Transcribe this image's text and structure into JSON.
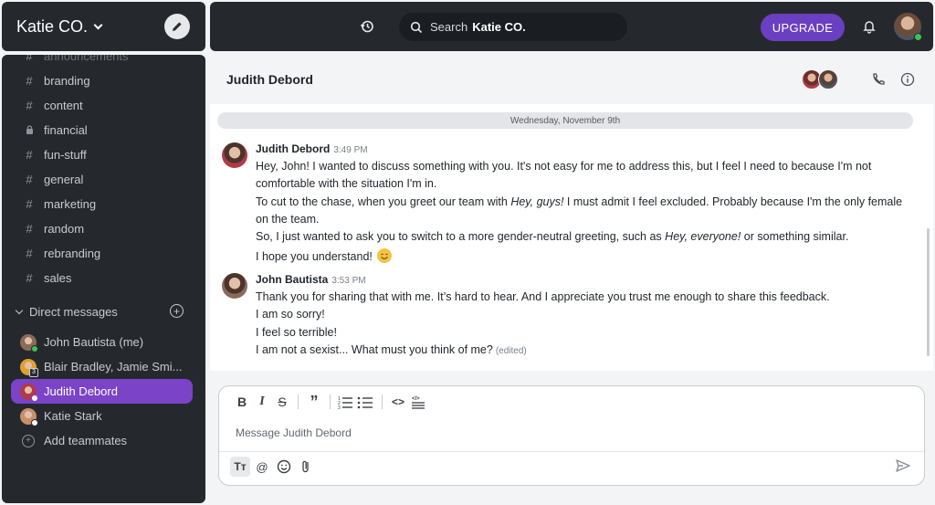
{
  "workspace": {
    "name": "Katie CO."
  },
  "channels": [
    {
      "name": "announcements",
      "icon": "hash",
      "faded": true
    },
    {
      "name": "branding",
      "icon": "hash"
    },
    {
      "name": "content",
      "icon": "hash"
    },
    {
      "name": "financial",
      "icon": "lock"
    },
    {
      "name": "fun-stuff",
      "icon": "hash"
    },
    {
      "name": "general",
      "icon": "hash"
    },
    {
      "name": "marketing",
      "icon": "hash"
    },
    {
      "name": "random",
      "icon": "hash"
    },
    {
      "name": "rebranding",
      "icon": "hash"
    },
    {
      "name": "sales",
      "icon": "hash"
    }
  ],
  "direct_messages": {
    "section_label": "Direct messages",
    "items": [
      {
        "name": "John Bautista (me)",
        "avatar_color": "#8a6b5a",
        "status_color": "#3fbf5a"
      },
      {
        "name": "Blair Bradley, Jamie Smi...",
        "avatar_color": "#e0a030",
        "badge": "3"
      },
      {
        "name": "Judith Debord",
        "avatar_color": "#b23a48",
        "status_color": "#ffffff",
        "active": true
      },
      {
        "name": "Katie Stark",
        "avatar_color": "#c88f6a",
        "status_color": "#ffffff"
      }
    ],
    "add_label": "Add teammates"
  },
  "topbar": {
    "search_prefix": "Search",
    "search_scope": "Katie CO.",
    "upgrade_label": "UPGRADE"
  },
  "conversation": {
    "title": "Judith Debord",
    "date_divider": "Wednesday, November 9th",
    "messages": [
      {
        "author": "Judith Debord",
        "time": "3:49 PM",
        "avatar_color": "#b23a48",
        "lines": [
          {
            "parts": [
              "Hey, John! I wanted to discuss something with you. It's not easy for me to address this, but I feel I need to because I'm not"
            ]
          },
          {
            "parts": [
              "comfortable with the situation I'm in."
            ]
          },
          {
            "parts": [
              "To cut to the chase, when you greet our team with ",
              "Hey, guys!",
              " I must admit I feel excluded. Probably because I'm the only female"
            ]
          },
          {
            "parts": [
              "on the team."
            ]
          },
          {
            "parts": [
              "So, I just wanted to ask you to switch to a more gender-neutral greeting, such as ",
              "Hey, everyone!",
              " or something similar."
            ]
          },
          {
            "parts": [
              "I hope you understand!"
            ],
            "emoji": "smiling-face-emoji"
          }
        ]
      },
      {
        "author": "John Bautista",
        "time": "3:53 PM",
        "avatar_color": "#8a6b5a",
        "lines": [
          {
            "parts": [
              "Thank you for sharing that with me. It’s hard to hear. And I appreciate you trust me enough to share this feedback."
            ]
          },
          {
            "parts": [
              "I am so sorry!"
            ]
          },
          {
            "parts": [
              "I feel so terrible!"
            ]
          },
          {
            "parts": [
              "I am not a sexist... What must you think of me?"
            ],
            "edited": "(edited)"
          }
        ]
      }
    ]
  },
  "composer": {
    "placeholder": "Message Judith Debord",
    "format_tools": [
      "B",
      "I",
      "S",
      "”",
      "1≡",
      "•≡",
      "<>",
      "code-block"
    ],
    "text_tool_label": "Tт"
  },
  "colors": {
    "sidebar_bg": "#25292e",
    "accent": "#7b43c8",
    "upgrade": "#6b3fc1",
    "online": "#3fbf5a"
  }
}
